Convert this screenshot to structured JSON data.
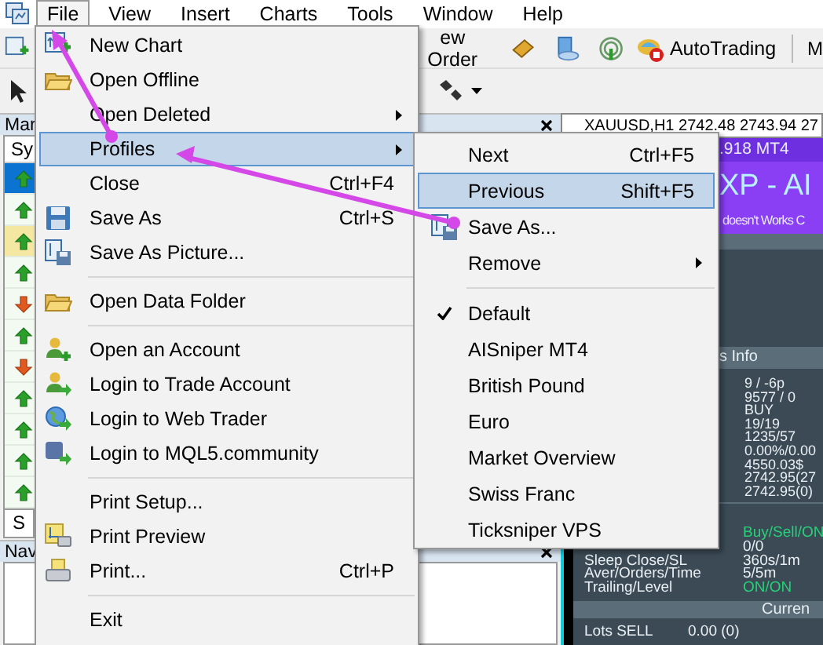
{
  "menubar": [
    {
      "label": "File",
      "selected": true
    },
    {
      "label": "View",
      "selected": false
    },
    {
      "label": "Insert",
      "selected": false
    },
    {
      "label": "Charts",
      "selected": false
    },
    {
      "label": "Tools",
      "selected": false
    },
    {
      "label": "Window",
      "selected": false
    },
    {
      "label": "Help",
      "selected": false
    }
  ],
  "toolbar": {
    "order_label": "ew Order",
    "autotrading_label": "AutoTrading",
    "cut_label": "M"
  },
  "market_watch": {
    "title": "Mar",
    "column": "Sy",
    "tab": "S",
    "rows": [
      {
        "kind": "up",
        "selected": true,
        "highlighted": false
      },
      {
        "kind": "up",
        "selected": false,
        "highlighted": false
      },
      {
        "kind": "up",
        "selected": false,
        "highlighted": true
      },
      {
        "kind": "up",
        "selected": false,
        "highlighted": false
      },
      {
        "kind": "down",
        "selected": false,
        "highlighted": false
      },
      {
        "kind": "up",
        "selected": false,
        "highlighted": false
      },
      {
        "kind": "down",
        "selected": false,
        "highlighted": false
      },
      {
        "kind": "up",
        "selected": false,
        "highlighted": false
      },
      {
        "kind": "up",
        "selected": false,
        "highlighted": false
      },
      {
        "kind": "up",
        "selected": false,
        "highlighted": false
      },
      {
        "kind": "up",
        "selected": false,
        "highlighted": false
      }
    ]
  },
  "navigator": {
    "title": "Nav"
  },
  "file_menu": {
    "items": [
      {
        "kind": "item",
        "label": "New Chart",
        "submenu": false,
        "selected": false
      },
      {
        "kind": "item",
        "label": "Open Offline",
        "submenu": false,
        "selected": false
      },
      {
        "kind": "item",
        "label": "Open Deleted",
        "submenu": true,
        "selected": false
      },
      {
        "kind": "item",
        "label": "Profiles",
        "submenu": true,
        "selected": true
      },
      {
        "kind": "item",
        "label": "Close",
        "shortcut": "Ctrl+F4",
        "submenu": false,
        "selected": false
      },
      {
        "kind": "item",
        "label": "Save As",
        "shortcut": "Ctrl+S",
        "submenu": false,
        "selected": false
      },
      {
        "kind": "item",
        "label": "Save As Picture...",
        "submenu": false,
        "selected": false
      },
      {
        "kind": "separator"
      },
      {
        "kind": "item",
        "label": "Open Data Folder",
        "submenu": false,
        "selected": false
      },
      {
        "kind": "separator"
      },
      {
        "kind": "item",
        "label": "Open an Account",
        "submenu": false,
        "selected": false
      },
      {
        "kind": "item",
        "label": "Login to Trade Account",
        "submenu": false,
        "selected": false
      },
      {
        "kind": "item",
        "label": "Login to Web Trader",
        "submenu": false,
        "selected": false
      },
      {
        "kind": "item",
        "label": "Login to MQL5.community",
        "submenu": false,
        "selected": false
      },
      {
        "kind": "separator"
      },
      {
        "kind": "item",
        "label": "Print Setup...",
        "submenu": false,
        "selected": false
      },
      {
        "kind": "item",
        "label": "Print Preview",
        "submenu": false,
        "selected": false
      },
      {
        "kind": "item",
        "label": "Print...",
        "shortcut": "Ctrl+P",
        "submenu": false,
        "selected": false
      },
      {
        "kind": "separator"
      },
      {
        "kind": "item",
        "label": "Exit",
        "submenu": false,
        "selected": false
      }
    ]
  },
  "profiles_menu": {
    "items": [
      {
        "kind": "item",
        "label": "Next",
        "shortcut": "Ctrl+F5",
        "submenu": false,
        "checked": false,
        "selected": false
      },
      {
        "kind": "item",
        "label": "Previous",
        "shortcut": "Shift+F5",
        "submenu": false,
        "checked": false,
        "selected": true
      },
      {
        "kind": "item",
        "label": "Save As...",
        "submenu": false,
        "checked": false,
        "selected": false
      },
      {
        "kind": "item",
        "label": "Remove",
        "submenu": true,
        "checked": false,
        "selected": false
      },
      {
        "kind": "separator"
      },
      {
        "kind": "item",
        "label": "Default",
        "submenu": false,
        "checked": true,
        "selected": false
      },
      {
        "kind": "item",
        "label": "AISniper MT4",
        "submenu": false,
        "checked": false,
        "selected": false
      },
      {
        "kind": "item",
        "label": "British Pound",
        "submenu": false,
        "checked": false,
        "selected": false
      },
      {
        "kind": "item",
        "label": "Euro",
        "submenu": false,
        "checked": false,
        "selected": false
      },
      {
        "kind": "item",
        "label": "Market Overview",
        "submenu": false,
        "checked": false,
        "selected": false
      },
      {
        "kind": "item",
        "label": "Swiss Franc",
        "submenu": false,
        "checked": false,
        "selected": false
      },
      {
        "kind": "item",
        "label": "Ticksniper VPS",
        "submenu": false,
        "checked": false,
        "selected": false
      }
    ]
  },
  "chart": {
    "title": "XAUUSD,H1  2742.48 2743.94 27",
    "banner": {
      "version": ".918 MT4",
      "name": "XP - AI",
      "note": "doesn't Works C"
    },
    "info_header": "s Info",
    "values": [
      "9 / -6p",
      "9577 / 0",
      "BUY",
      "19/19",
      "1235/57",
      "0.00%/0.00",
      "4550.03$",
      "2742.95(27",
      "2742.95(0)"
    ],
    "status_rows": [
      {
        "label": "",
        "value": "Buy/Sell/ON",
        "on": true
      },
      {
        "label": "",
        "value": "0/0",
        "on": false
      },
      {
        "label": "Sleep Close/SL",
        "value": "360s/1m",
        "on": false
      },
      {
        "label": "Aver/Orders/Time",
        "value": "5/5m",
        "on": false
      },
      {
        "label": "Trailing/Level",
        "value": "ON/ON",
        "on": true
      }
    ],
    "current_header": "Curren",
    "lots": {
      "label": "Lots SELL",
      "value": "0.00 (0)"
    }
  }
}
